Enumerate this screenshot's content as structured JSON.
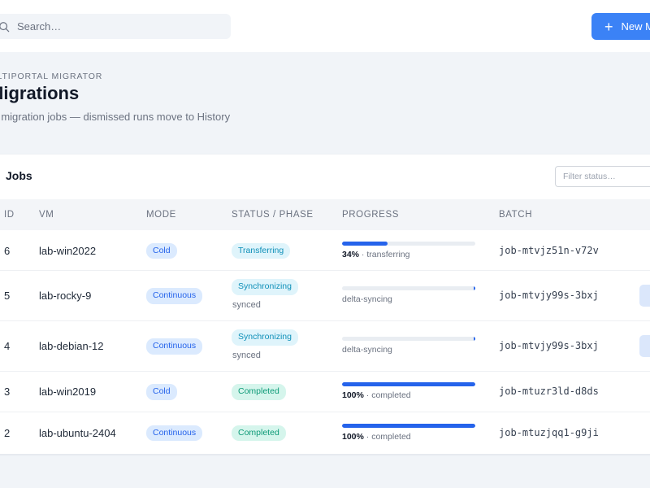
{
  "search": {
    "placeholder": "Search…"
  },
  "header": {
    "new_button_label": "New M"
  },
  "page": {
    "eyebrow": "ULTIPORTAL MIGRATOR",
    "title": "Migrations",
    "subtitle": "ve migration jobs — dismissed runs move to History"
  },
  "jobs": {
    "title": "Jobs",
    "filter_placeholder": "Filter status…",
    "columns": {
      "id": "ID",
      "vm": "VM",
      "mode": "MODE",
      "status": "STATUS / PHASE",
      "progress": "PROGRESS",
      "batch": "BATCH"
    },
    "rows": [
      {
        "id": "6",
        "vm": "lab-win2022",
        "mode": "Cold",
        "status": "Transferring",
        "phase": "",
        "progress": 0.34,
        "progress_pct": "34%",
        "progress_label": " · transferring",
        "batch": "job-mtvjz51n-v72v",
        "has_action": false
      },
      {
        "id": "5",
        "vm": "lab-rocky-9",
        "mode": "Continuous",
        "status": "Synchronizing",
        "phase": "synced",
        "progress": 1.0,
        "progress_pct": "",
        "progress_label": "delta-syncing",
        "batch": "job-mtvjy99s-3bxj",
        "has_action": true
      },
      {
        "id": "4",
        "vm": "lab-debian-12",
        "mode": "Continuous",
        "status": "Synchronizing",
        "phase": "synced",
        "progress": 1.0,
        "progress_pct": "",
        "progress_label": "delta-syncing",
        "batch": "job-mtvjy99s-3bxj",
        "has_action": true
      },
      {
        "id": "3",
        "vm": "lab-win2019",
        "mode": "Cold",
        "status": "Completed",
        "phase": "",
        "progress": 1.0,
        "progress_pct": "100%",
        "progress_label": " · completed",
        "batch": "job-mtuzr3ld-d8ds",
        "has_action": false
      },
      {
        "id": "2",
        "vm": "lab-ubuntu-2404",
        "mode": "Continuous",
        "status": "Completed",
        "phase": "",
        "progress": 1.0,
        "progress_pct": "100%",
        "progress_label": " · completed",
        "batch": "job-mtuzjqq1-g9ji",
        "has_action": false
      }
    ]
  },
  "icons": {
    "search": "search-icon",
    "new": "plus-icon"
  },
  "colors": {
    "accent": "#3b82f6",
    "progress": "#2563eb",
    "page_bg": "#f1f4f8"
  }
}
